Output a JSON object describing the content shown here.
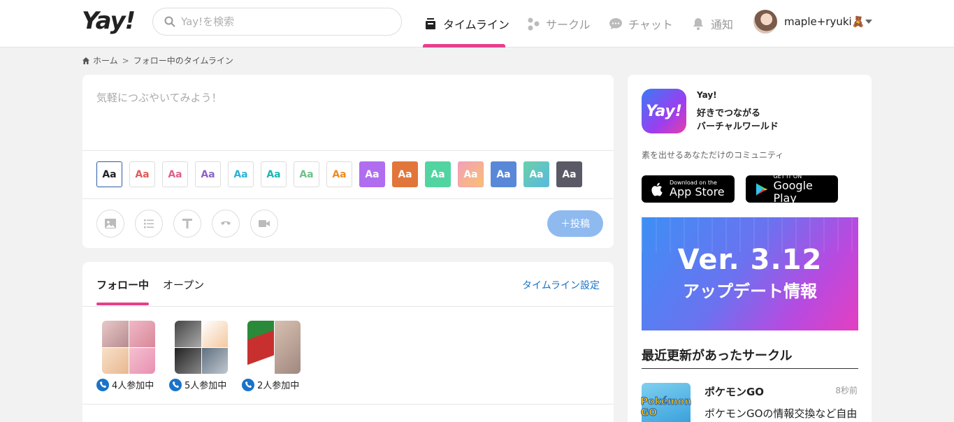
{
  "header": {
    "logo": "Yay!",
    "search_placeholder": "Yay!を検索",
    "nav": [
      {
        "label": "タイムライン",
        "icon": "timeline-icon",
        "active": true
      },
      {
        "label": "サークル",
        "icon": "circle-icon"
      },
      {
        "label": "チャット",
        "icon": "chat-icon"
      },
      {
        "label": "通知",
        "icon": "bell-icon"
      }
    ],
    "user_name": "maple+ryuki🧸"
  },
  "breadcrumb": {
    "home": "ホーム",
    "sep": ">",
    "current": "フォロー中のタイムライン"
  },
  "composer": {
    "placeholder": "気軽につぶやいてみよう！",
    "font_label": "Aa",
    "font_colors": [
      "#222222",
      "#e05a5a",
      "#e0608a",
      "#8a64c8",
      "#2bb3d6",
      "#19b8b0",
      "#6cc08a",
      "#f08a24"
    ],
    "font_fills": [
      "#b06df0",
      "#e2763a",
      "#52d4a0",
      "#f2a0b8",
      "#5a88d8",
      "#62c8c0",
      "#5a5a66"
    ],
    "tools": [
      "image-icon",
      "list-icon",
      "text-icon",
      "phone-icon",
      "video-icon"
    ],
    "post_label": "＋投稿"
  },
  "timeline": {
    "tabs": [
      "フォロー中",
      "オープン"
    ],
    "settings_label": "タイムライン設定",
    "calls": [
      {
        "label": "4人参加中"
      },
      {
        "label": "5人参加中"
      },
      {
        "label": "2人参加中"
      }
    ]
  },
  "sidebar": {
    "app_icon_text": "Yay!",
    "app_name": "Yay!",
    "tagline_1": "好きでつながる",
    "tagline_2": "バーチャルワールド",
    "desc": "素を出せるあなただけのコミュニティ",
    "appstore_small": "Download on the",
    "appstore_big": "App Store",
    "googleplay_small": "GET IT ON",
    "googleplay_big": "Google Play",
    "banner_version": "Ver. 3.12",
    "banner_sub": "アップデート情報",
    "recent_title": "最近更新があったサークル",
    "circle": {
      "thumb_text": "Pokémon GO",
      "name": "ポケモンGO",
      "time": "8秒前",
      "desc": "ポケモンGOの情報交換など自由"
    }
  },
  "colors": {
    "accent": "#e83e8c",
    "link": "#1a73c8",
    "post_button": "#8fbaf0"
  }
}
